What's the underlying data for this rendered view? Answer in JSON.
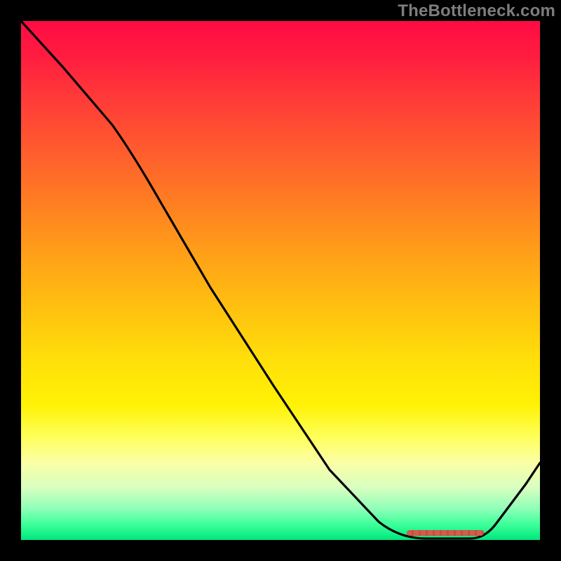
{
  "watermark": "TheBottleneck.com",
  "chart_data": {
    "type": "line",
    "title": "",
    "xlabel": "",
    "ylabel": "",
    "x": [
      0.0,
      0.07,
      0.14,
      0.21,
      0.28,
      0.35,
      0.42,
      0.49,
      0.56,
      0.63,
      0.7,
      0.76,
      0.83,
      0.87,
      0.93,
      1.0
    ],
    "values": [
      1.0,
      0.9,
      0.8,
      0.7,
      0.58,
      0.44,
      0.31,
      0.18,
      0.05,
      0.0,
      0.0,
      0.0,
      0.0,
      0.0,
      0.06,
      0.15
    ],
    "ylim": [
      0,
      1
    ],
    "xlim": [
      0,
      1
    ],
    "marker_band": {
      "x_start": 0.74,
      "x_end": 0.89,
      "y": 0.01
    },
    "background_gradient": [
      "#ff0b44",
      "#ffde0a",
      "#00e77e"
    ]
  }
}
